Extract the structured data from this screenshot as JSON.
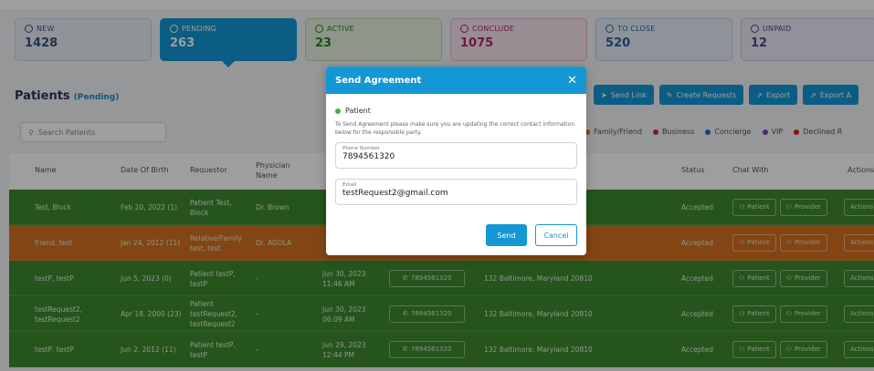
{
  "cards": [
    {
      "label": "NEW",
      "count": "1428"
    },
    {
      "label": "PENDING",
      "count": "263"
    },
    {
      "label": "ACTIVE",
      "count": "23"
    },
    {
      "label": "CONCLUDE",
      "count": "1075"
    },
    {
      "label": "TO CLOSE",
      "count": "520"
    },
    {
      "label": "UNPAID",
      "count": "12"
    }
  ],
  "title": "Patients",
  "title_sub": "(Pending)",
  "buttons": {
    "send_link": "Send Link",
    "create_requests": "Create Requests",
    "export": "Export",
    "export_all": "Export A"
  },
  "search_placeholder": "Search Patients",
  "legend": [
    {
      "label": "Family/Friend",
      "color": "#d4701f"
    },
    {
      "label": "Business",
      "color": "#c0392b"
    },
    {
      "label": "Concierge",
      "color": "#1a73c9"
    },
    {
      "label": "VIP",
      "color": "#7b3fbf"
    },
    {
      "label": "Declined R",
      "color": "#d0242b"
    }
  ],
  "columns": {
    "name": "Name",
    "dob": "Date Of Birth",
    "requestor": "Requestor",
    "physician": "Physician Name",
    "status": "Status",
    "chat_with": "Chat With",
    "actions": "Actions"
  },
  "rows": [
    {
      "name": "Test, Block",
      "dob": "Feb 20, 2022 (1)",
      "requestor": "Patient Test, Block",
      "physician": "Dr. Brown",
      "date": "",
      "phone": "",
      "address": "",
      "status": "Accepted",
      "color": "green"
    },
    {
      "name": "friend, test",
      "dob": "Jan 24, 2012 (11)",
      "requestor": "Relative/Family test, test",
      "physician": "Dr. AGOLA",
      "date": "",
      "phone": "",
      "address": "",
      "status": "Accepted",
      "color": "orange"
    },
    {
      "name": "testP, testP",
      "dob": "Jun 5, 2023 (0)",
      "requestor": "Patient testP, testP",
      "physician": "-",
      "date": "Jun 30, 2023 11:46 AM",
      "phone": "7894561320",
      "address": "132 Baltimore, Maryland 20810",
      "status": "Accepted",
      "color": "green"
    },
    {
      "name": "testRequest2, testRequest2",
      "dob": "Apr 18, 2000 (23)",
      "requestor": "Patient testRequest2, testRequest2",
      "physician": "-",
      "date": "Jun 30, 2023 06:09 AM",
      "phone": "7894561320",
      "address": "132 Baltimore, Maryland 20810",
      "status": "Accepted",
      "color": "green"
    },
    {
      "name": "testP, testP",
      "dob": "Jun 2, 2012 (11)",
      "requestor": "Patient testP, testP",
      "physician": "-",
      "date": "Jun 29, 2023 12:44 PM",
      "phone": "7894561320",
      "address": "132 Baltimore, Maryland 20810",
      "status": "Accepted",
      "color": "green"
    }
  ],
  "chat": {
    "patient": "Patient",
    "provider": "Provider"
  },
  "row_action": "Actions",
  "modal": {
    "title": "Send Agreement",
    "close": "✕",
    "role": "Patient",
    "hint": "To Send Agreement please make sure you are updating the correct contact information below for the responsible party.",
    "phone_label": "Phone Number",
    "phone_value": "7894561320",
    "email_label": "Email",
    "email_value": "testRequest2@gmail.com",
    "send": "Send",
    "cancel": "Cancel"
  }
}
